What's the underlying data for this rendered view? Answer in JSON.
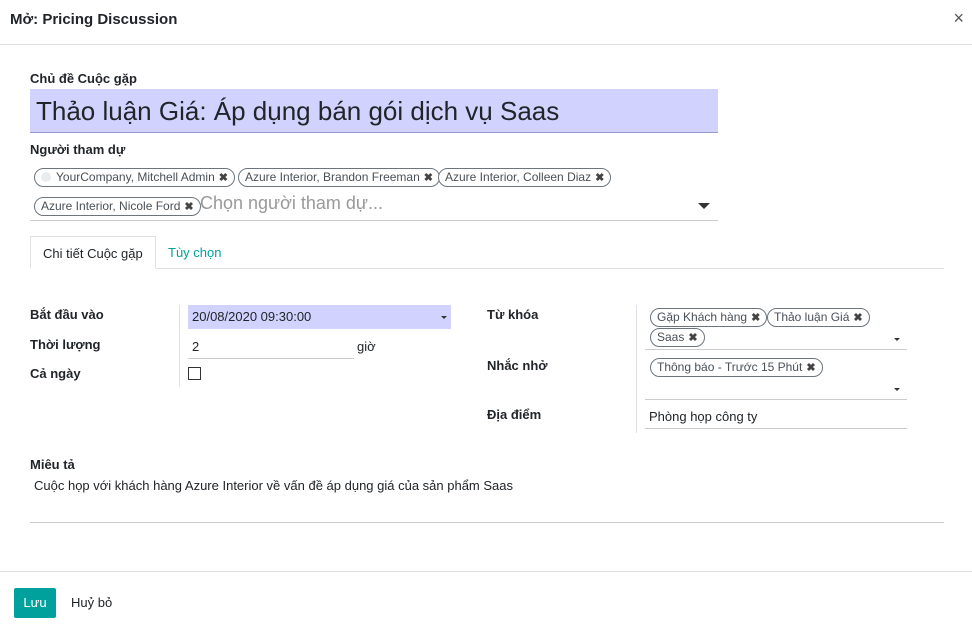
{
  "dialog": {
    "title": "Mở: Pricing Discussion",
    "close_symbol": "×"
  },
  "subject": {
    "label": "Chủ đề Cuộc gặp",
    "value": "Thảo luận Giá: Áp dụng bán gói dịch vụ Saas"
  },
  "attendees": {
    "label": "Người tham dự",
    "tags": [
      "YourCompany, Mitchell Admin",
      "Azure Interior, Brandon Freeman",
      "Azure Interior, Colleen Diaz",
      "Azure Interior, Nicole Ford"
    ],
    "placeholder": "Chọn người tham dự..."
  },
  "tabs": [
    {
      "label": "Chi tiết Cuộc gặp",
      "active": true
    },
    {
      "label": "Tùy chọn",
      "active": false
    }
  ],
  "left_fields": {
    "start_label": "Bắt đầu vào",
    "start_value": "20/08/2020 09:30:00",
    "duration_label": "Thời lượng",
    "duration_value": "2",
    "duration_unit": "giờ",
    "allday_label": "Cả ngày",
    "allday_checked": false
  },
  "right_fields": {
    "tags_label": "Từ khóa",
    "tags": [
      "Gặp Khách hàng",
      "Thảo luận Giá",
      "Saas"
    ],
    "reminders_label": "Nhắc nhở",
    "reminders": [
      "Thông báo - Trước 15 Phút"
    ],
    "location_label": "Địa điểm",
    "location_value": "Phòng họp công ty"
  },
  "description": {
    "label": "Miêu tả",
    "value": "Cuộc họp với khách hàng Azure Interior về vấn đề áp dụng giá của sản phẩm Saas"
  },
  "footer": {
    "save_label": "Lưu",
    "cancel_label": "Huỷ bỏ"
  },
  "colors": {
    "accent": "#00a09d",
    "required_field_bg": "#d2d2ff"
  }
}
